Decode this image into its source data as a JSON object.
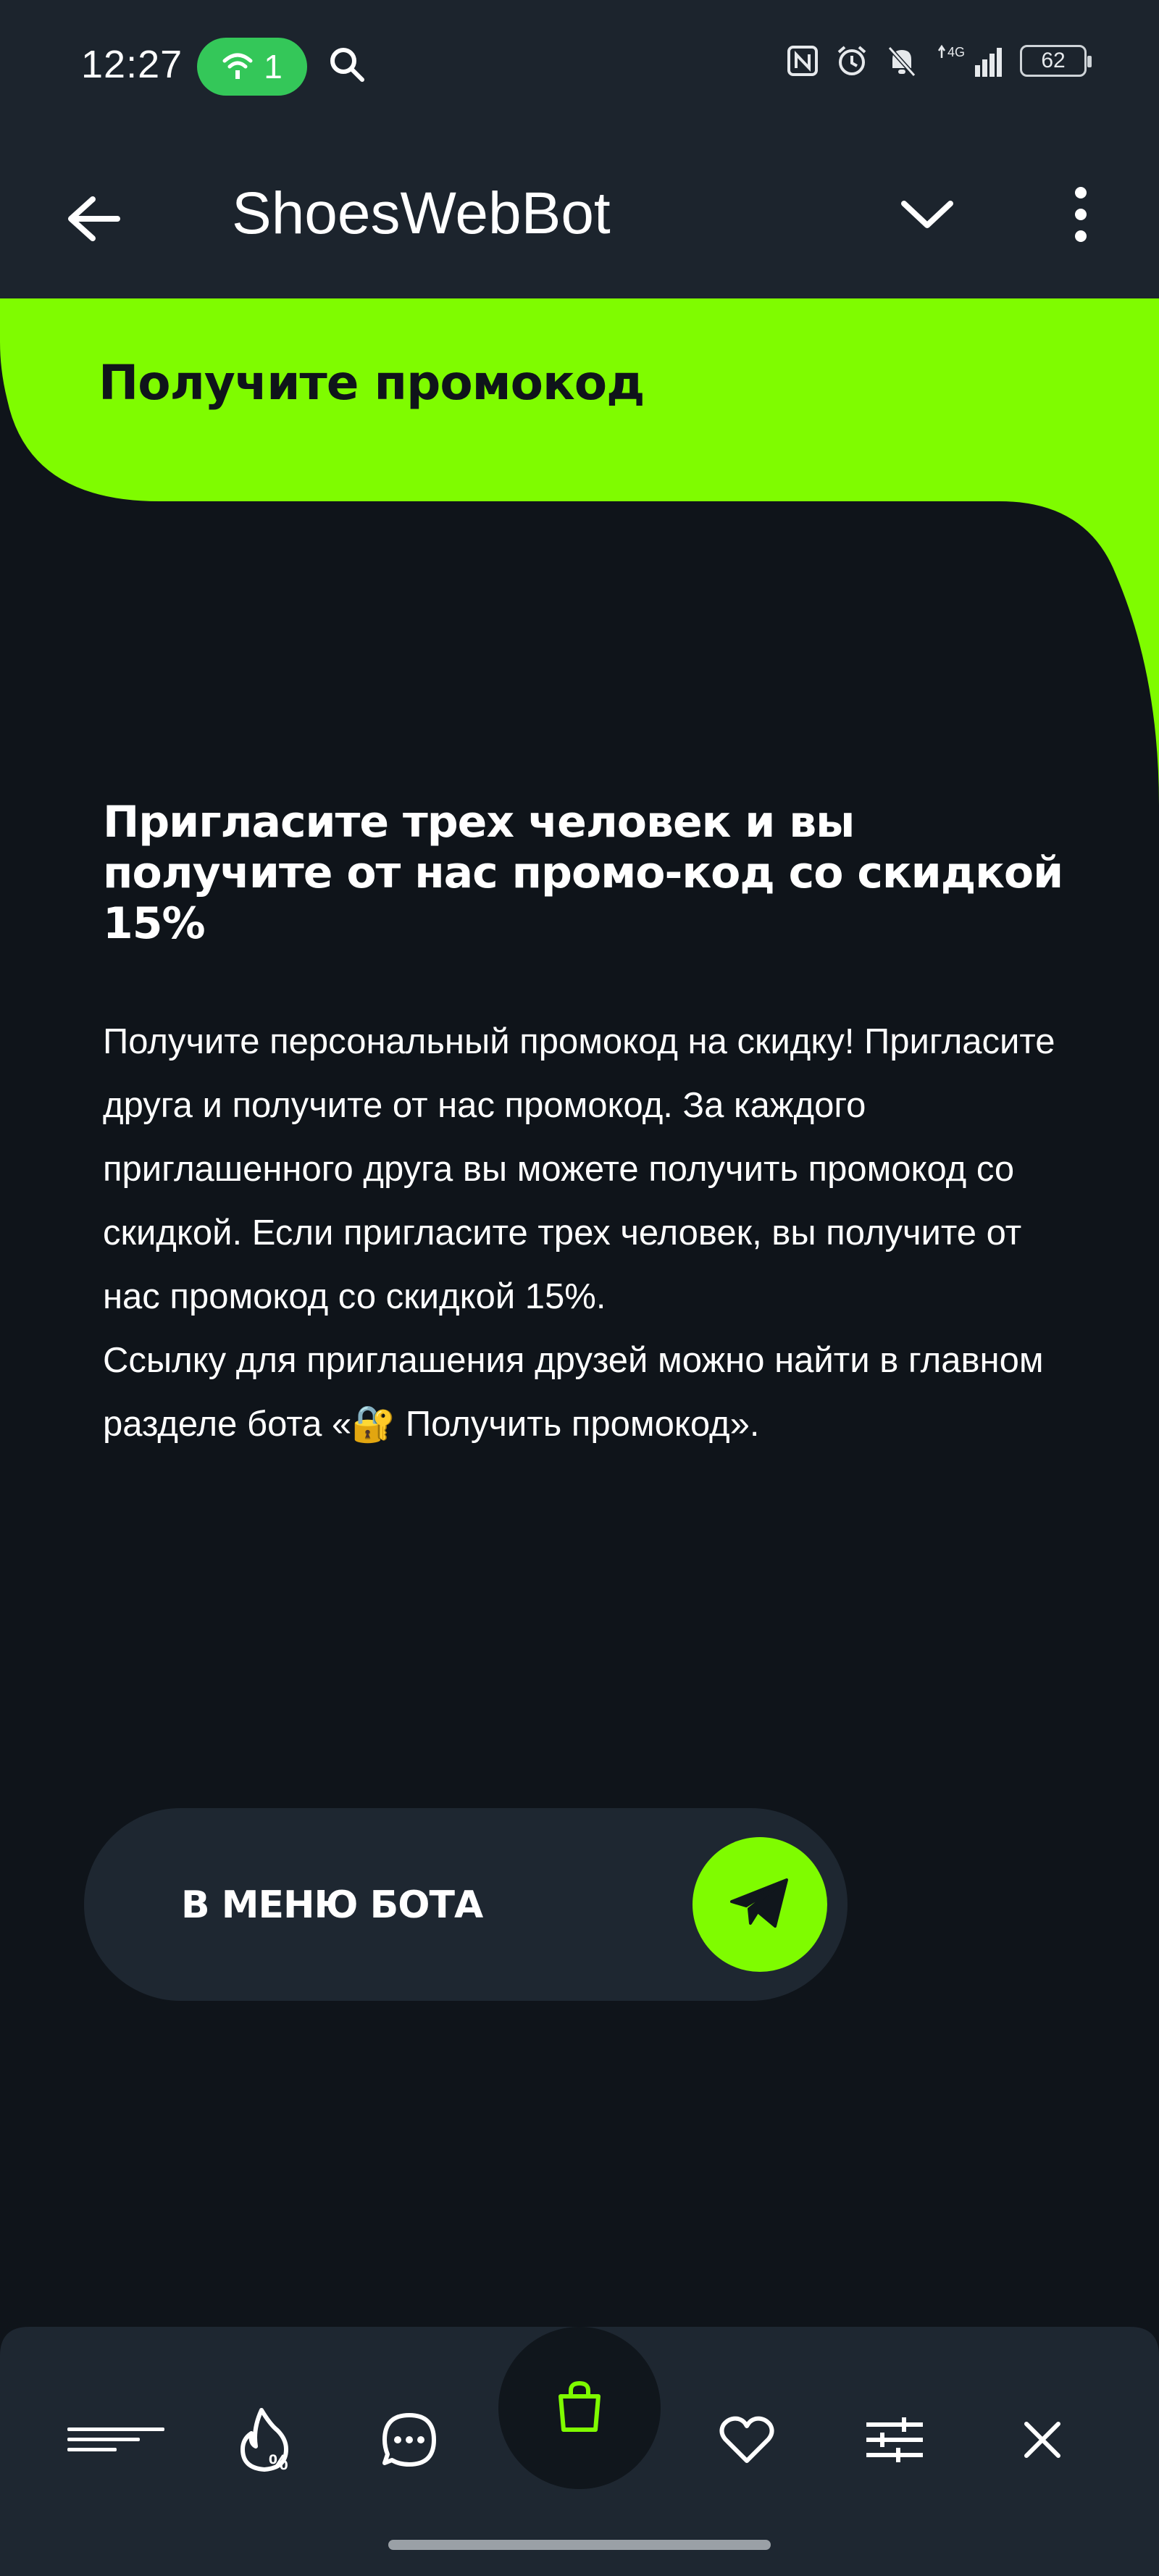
{
  "status_bar": {
    "time": "12:27",
    "hotspot_count": "1",
    "network": "4G",
    "battery_level": "62",
    "icons": [
      "hotspot-icon",
      "search-icon",
      "nfc-icon",
      "alarm-icon",
      "mute-icon",
      "signal-icon",
      "battery-icon"
    ]
  },
  "app_bar": {
    "title": "ShoesWebBot",
    "icons": [
      "back-arrow-icon",
      "chevron-down-icon",
      "more-vertical-icon"
    ]
  },
  "hero": {
    "title": "Получите промокод"
  },
  "content": {
    "heading": "Пригласите трех человек и вы получите от нас промо-код со скидкой 15%",
    "paragraphs": [
      "Получите персональный промокод на скидку! Пригласите друга и получите от нас промокод. За каждого приглашенного друга вы можете получить промокод со скидкой. Если пригласите трех человек, вы получите от нас промокод со скидкой 15%.",
      "Ссылку для приглашения друзей можно найти в главном разделе бота «🔐 Получить промокод»."
    ]
  },
  "menu_button": {
    "label": "В МЕНЮ БОТА",
    "icon": "telegram-send-icon"
  },
  "bottom_nav": {
    "items": [
      "menu-lines-icon",
      "fire-discount-icon",
      "chat-icon",
      "shopping-bag-icon",
      "heart-icon",
      "filter-sliders-icon",
      "close-icon"
    ]
  },
  "colors": {
    "accent": "#7ffc00",
    "background": "#0f141a",
    "bar": "#1c242d",
    "hotspot": "#34c759"
  }
}
